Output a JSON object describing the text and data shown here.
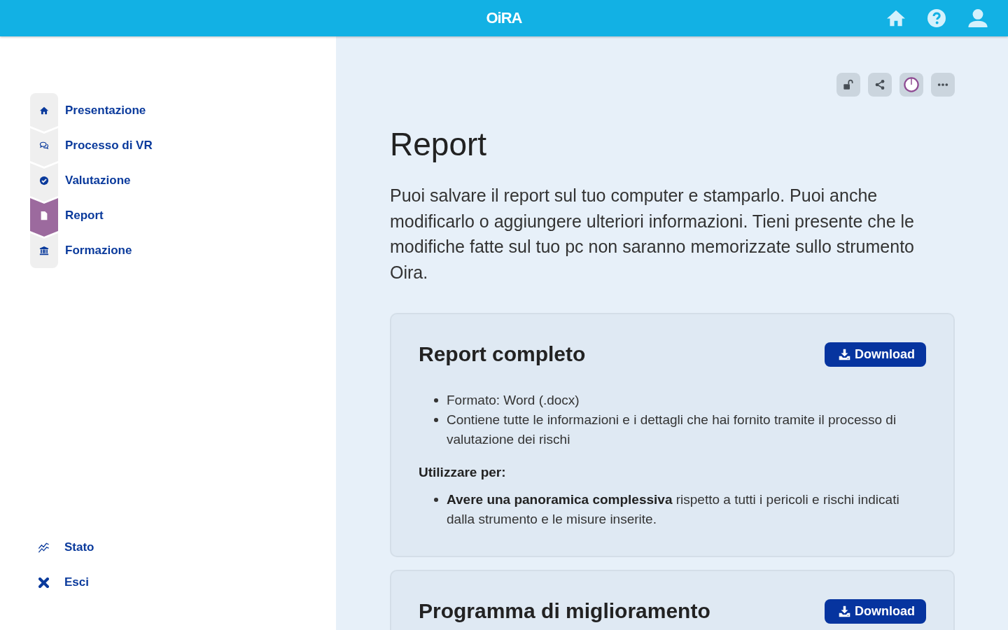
{
  "header": {
    "brand": "OiRA"
  },
  "sidebar": {
    "steps": [
      {
        "label": "Presentazione",
        "selected": false
      },
      {
        "label": "Processo di VR",
        "selected": false
      },
      {
        "label": "Valutazione",
        "selected": false
      },
      {
        "label": "Report",
        "selected": true
      },
      {
        "label": "Formazione",
        "selected": false
      }
    ],
    "footer_links": [
      "Stato",
      "Esci"
    ]
  },
  "page": {
    "title": "Report",
    "intro": "Puoi salvare il report sul tuo computer e stamparlo. Puoi anche modificarlo o aggiungere ulteriori informazioni. Tieni presente che le modifiche fatte sul tuo pc non saranno memorizzate sullo strumento Oira."
  },
  "sections": [
    {
      "title": "Report completo",
      "button": "Download",
      "details": [
        "Formato: Word (.docx)",
        "Contiene tutte le informazioni e i dettagli che hai fornito tramite il processo di valutazione dei rischi"
      ],
      "use_label": "Utilizzare per:",
      "uses": [
        "**Avere una panoramica complessiva** rispetto a tutti i pericoli e rischi indicati dalla strumento e le misure inserite."
      ]
    },
    {
      "title": "Programma di miglioramento",
      "button": "Download"
    }
  ]
}
